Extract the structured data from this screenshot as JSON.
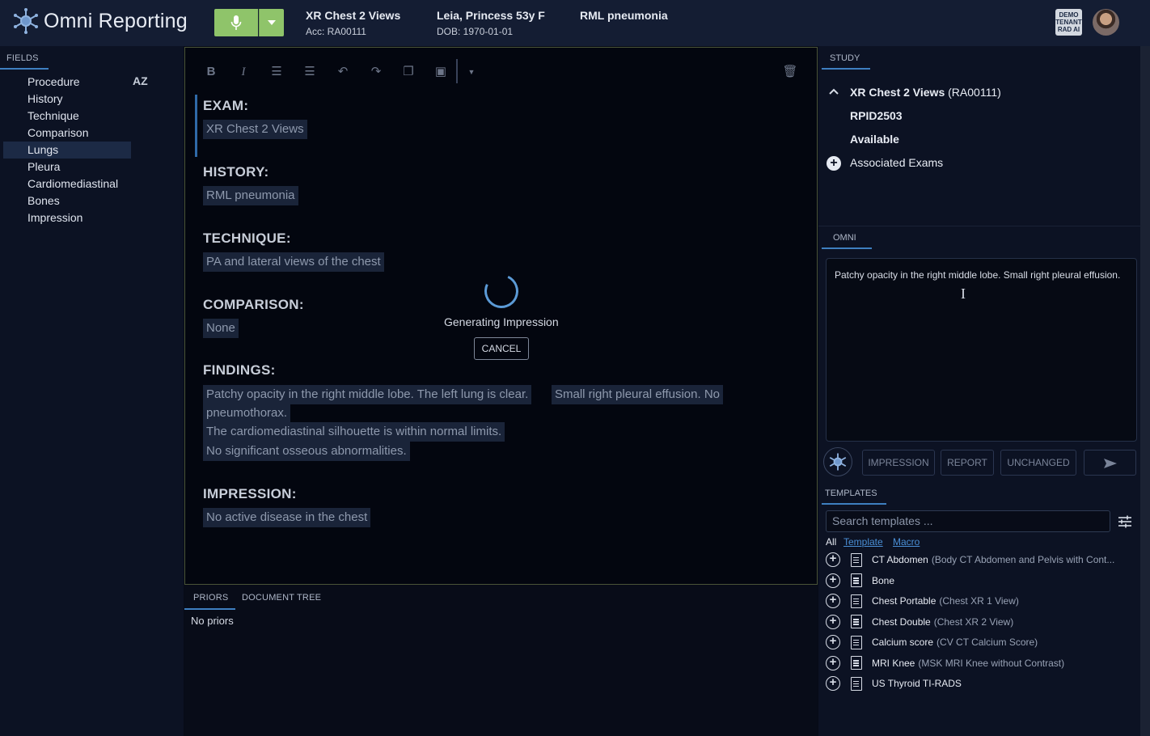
{
  "app": {
    "title": "Omni Reporting"
  },
  "header": {
    "study_title": "XR Chest 2 Views",
    "accession": "Acc: RA00111",
    "patient_name": "Leia, Princess 53y F",
    "dob": "DOB: 1970-01-01",
    "reason": "RML pneumonia",
    "tenant_badge": "DEMO TENANT RAD AI"
  },
  "fields_panel": {
    "tab_label": "FIELDS",
    "sort_label": "AZ",
    "items": [
      {
        "label": "Procedure",
        "active": false
      },
      {
        "label": "History",
        "active": false
      },
      {
        "label": "Technique",
        "active": false
      },
      {
        "label": "Comparison",
        "active": false
      },
      {
        "label": "Lungs",
        "active": true
      },
      {
        "label": "Pleura",
        "active": false
      },
      {
        "label": "Cardiomediastinal",
        "active": false
      },
      {
        "label": "Bones",
        "active": false
      },
      {
        "label": "Impression",
        "active": false
      }
    ]
  },
  "editor": {
    "sections": [
      {
        "heading": "EXAM:",
        "lines": [
          "XR Chest 2 Views"
        ]
      },
      {
        "heading": "HISTORY:",
        "lines": [
          "RML pneumonia"
        ]
      },
      {
        "heading": "TECHNIQUE:",
        "lines": [
          "PA and lateral views of the chest"
        ]
      },
      {
        "heading": "COMPARISON:",
        "lines": [
          "None"
        ]
      },
      {
        "heading": "FINDINGS:",
        "lines": [
          "Patchy opacity in the right middle lobe. The left lung is clear.",
          "Small right pleural effusion. No",
          "pneumothorax.",
          "The cardiomediastinal silhouette is within normal limits.",
          "No significant osseous abnormalities."
        ]
      },
      {
        "heading": "IMPRESSION:",
        "lines": [
          "No active disease in the chest"
        ]
      }
    ],
    "loading_text": "Generating Impression",
    "cancel_label": "CANCEL"
  },
  "bottom_panel": {
    "tabs": [
      "PRIORS",
      "DOCUMENT TREE"
    ],
    "priors_text": "No priors"
  },
  "study_panel": {
    "tab_label": "STUDY",
    "exam_name": "XR Chest 2 Views",
    "exam_acc": "(RA00111)",
    "rpid": "RPID2503",
    "status": "Available",
    "associated_label": "Associated Exams"
  },
  "omni_panel": {
    "tab_label": "OMNI",
    "text": "Patchy opacity in the right middle lobe. Small right pleural effusion.",
    "buttons": [
      "IMPRESSION",
      "REPORT",
      "UNCHANGED"
    ],
    "send_icon": "send-arrow-icon"
  },
  "templates_panel": {
    "tab_label": "TEMPLATES",
    "search_placeholder": "Search templates ...",
    "filters": [
      "All",
      "Template",
      "Macro"
    ],
    "items": [
      {
        "name": "CT Abdomen",
        "desc": "(Body CT Abdomen and Pelvis with Cont..."
      },
      {
        "name": "Bone",
        "desc": ""
      },
      {
        "name": "Chest Portable",
        "desc": "(Chest XR 1 View)"
      },
      {
        "name": "Chest Double",
        "desc": "(Chest XR 2 View)"
      },
      {
        "name": "Calcium score",
        "desc": "(CV CT Calcium Score)"
      },
      {
        "name": "MRI Knee",
        "desc": "(MSK MRI Knee without Contrast)"
      },
      {
        "name": "US Thyroid TI-RADS",
        "desc": ""
      }
    ]
  },
  "colors": {
    "accent_blue": "#3e7fc0",
    "mic_green": "#8fc46a",
    "header_bg": "#141d33",
    "chip_bg": "#1a2439"
  }
}
